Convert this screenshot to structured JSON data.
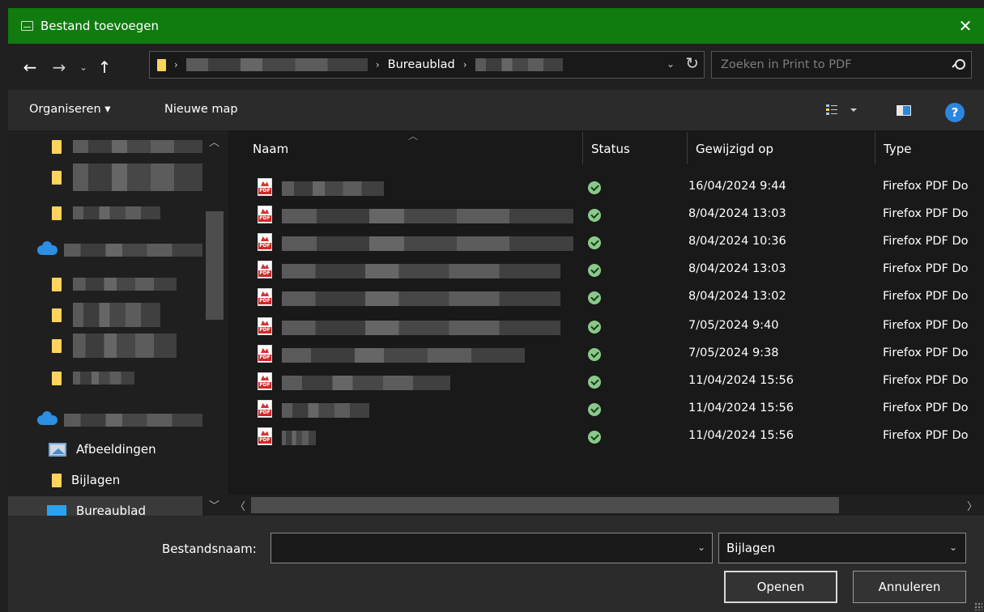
{
  "window": {
    "title": "Bestand toevoegen",
    "close_glyph": "✕"
  },
  "nav": {
    "back_glyph": "←",
    "forward_glyph": "→",
    "recent_glyph": "⌄",
    "up_glyph": "↑"
  },
  "address": {
    "crumb_visible": "Bureaublad",
    "separator": "›",
    "dropdown_glyph": "⌄",
    "refresh_glyph": "↻"
  },
  "search": {
    "placeholder": "Zoeken in Print to PDF"
  },
  "toolbar": {
    "organize_label": "Organiseren ▾",
    "new_folder_label": "Nieuwe map",
    "help_label": "?"
  },
  "navpane": {
    "items": [
      {
        "label": "Afbeeldingen",
        "icon": "pictures-icon"
      },
      {
        "label": "Bijlagen",
        "icon": "folder-icon"
      },
      {
        "label": "Bureaublad",
        "icon": "desktop-icon"
      }
    ]
  },
  "columns": {
    "name": "Naam",
    "status": "Status",
    "modified": "Gewijzigd op",
    "type": "Type"
  },
  "files": [
    {
      "modified": "16/04/2024 9:44",
      "type": "Firefox PDF Do"
    },
    {
      "modified": "8/04/2024 13:03",
      "type": "Firefox PDF Do"
    },
    {
      "modified": "8/04/2024 10:36",
      "type": "Firefox PDF Do"
    },
    {
      "modified": "8/04/2024 13:03",
      "type": "Firefox PDF Do"
    },
    {
      "modified": "8/04/2024 13:02",
      "type": "Firefox PDF Do"
    },
    {
      "modified": "7/05/2024 9:40",
      "type": "Firefox PDF Do"
    },
    {
      "modified": "7/05/2024 9:38",
      "type": "Firefox PDF Do"
    },
    {
      "modified": "11/04/2024 15:56",
      "type": "Firefox PDF Do"
    },
    {
      "modified": "11/04/2024 15:56",
      "type": "Firefox PDF Do"
    },
    {
      "modified": "11/04/2024 15:56",
      "type": "Firefox PDF Do"
    }
  ],
  "pdf_badge": "PDF",
  "bottom": {
    "filename_label": "Bestandsnaam:",
    "filename_value": "",
    "filetype_value": "Bijlagen",
    "open_label": "Openen",
    "cancel_label": "Annuleren"
  },
  "colors": {
    "titlebar": "#107c10",
    "background": "#191919",
    "accent_blue": "#2b86e0"
  }
}
